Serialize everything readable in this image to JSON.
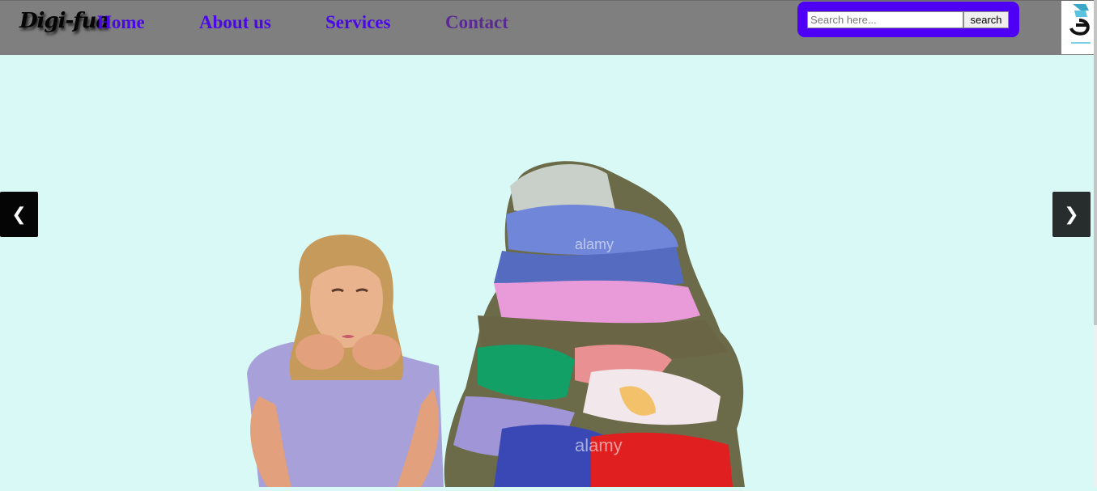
{
  "brand": {
    "logo_text": "Digi-fua"
  },
  "nav": {
    "home": "Home",
    "about": "About us",
    "services": "Services",
    "contact": "Contact"
  },
  "search": {
    "placeholder": "Search here...",
    "button_label": "search"
  },
  "slider": {
    "prev_symbol": "❮",
    "next_symbol": "❯",
    "watermark": "alamy"
  },
  "colors": {
    "nav_background": "#7f7f7f",
    "nav_link": "#4b08e8",
    "nav_link_visited": "#5a2a93",
    "search_container": "#4d00f4",
    "page_background": "#d8f9f6"
  },
  "icons": {
    "prev": "chevron-left-icon",
    "next": "chevron-right-icon"
  }
}
